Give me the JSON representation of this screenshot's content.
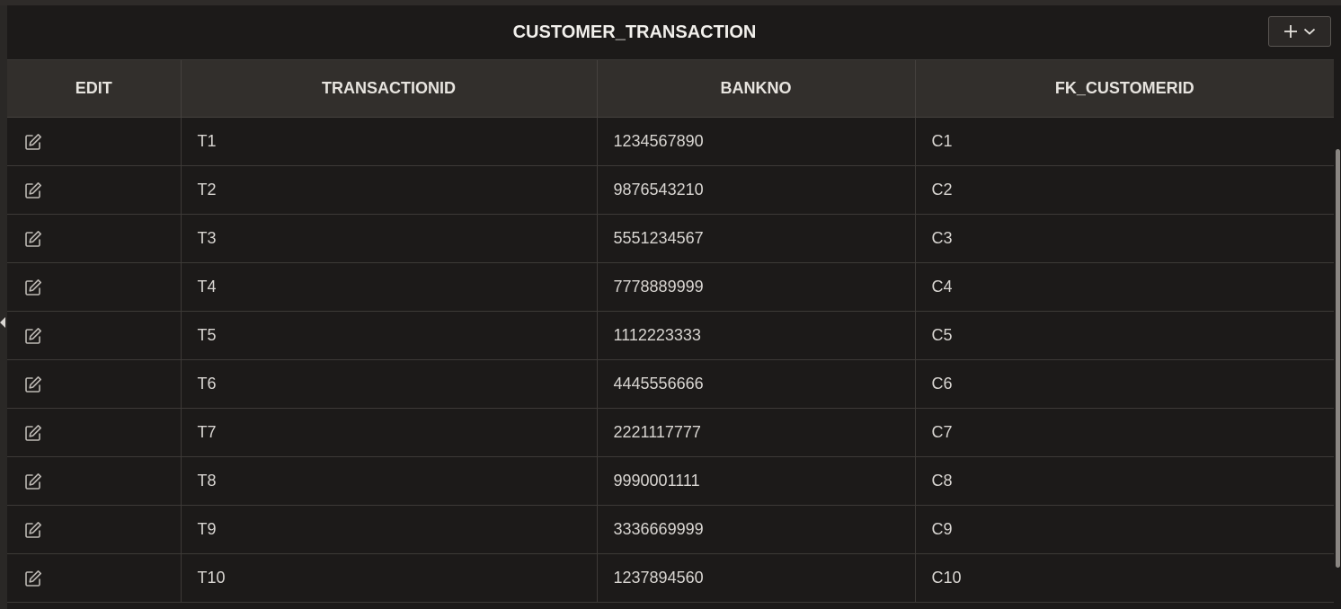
{
  "region": {
    "title": "CUSTOMER_TRANSACTION",
    "actions_icons": [
      "plus-icon",
      "chevron-down-icon"
    ]
  },
  "table": {
    "columns": [
      "EDIT",
      "TRANSACTIONID",
      "BANKNO",
      "FK_CUSTOMERID"
    ],
    "rows": [
      {
        "transactionid": "T1",
        "bankno": "1234567890",
        "fk_customerid": "C1"
      },
      {
        "transactionid": "T2",
        "bankno": "9876543210",
        "fk_customerid": "C2"
      },
      {
        "transactionid": "T3",
        "bankno": "5551234567",
        "fk_customerid": "C3"
      },
      {
        "transactionid": "T4",
        "bankno": "7778889999",
        "fk_customerid": "C4"
      },
      {
        "transactionid": "T5",
        "bankno": "1112223333",
        "fk_customerid": "C5"
      },
      {
        "transactionid": "T6",
        "bankno": "4445556666",
        "fk_customerid": "C6"
      },
      {
        "transactionid": "T7",
        "bankno": "2221117777",
        "fk_customerid": "C7"
      },
      {
        "transactionid": "T8",
        "bankno": "9990001111",
        "fk_customerid": "C8"
      },
      {
        "transactionid": "T9",
        "bankno": "3336669999",
        "fk_customerid": "C9"
      },
      {
        "transactionid": "T10",
        "bankno": "1237894560",
        "fk_customerid": "C10"
      }
    ],
    "edit_icon": "edit-icon"
  },
  "colors": {
    "background": "#1c1a19",
    "header_bg": "#322f2c",
    "text": "#d9d6d2"
  }
}
